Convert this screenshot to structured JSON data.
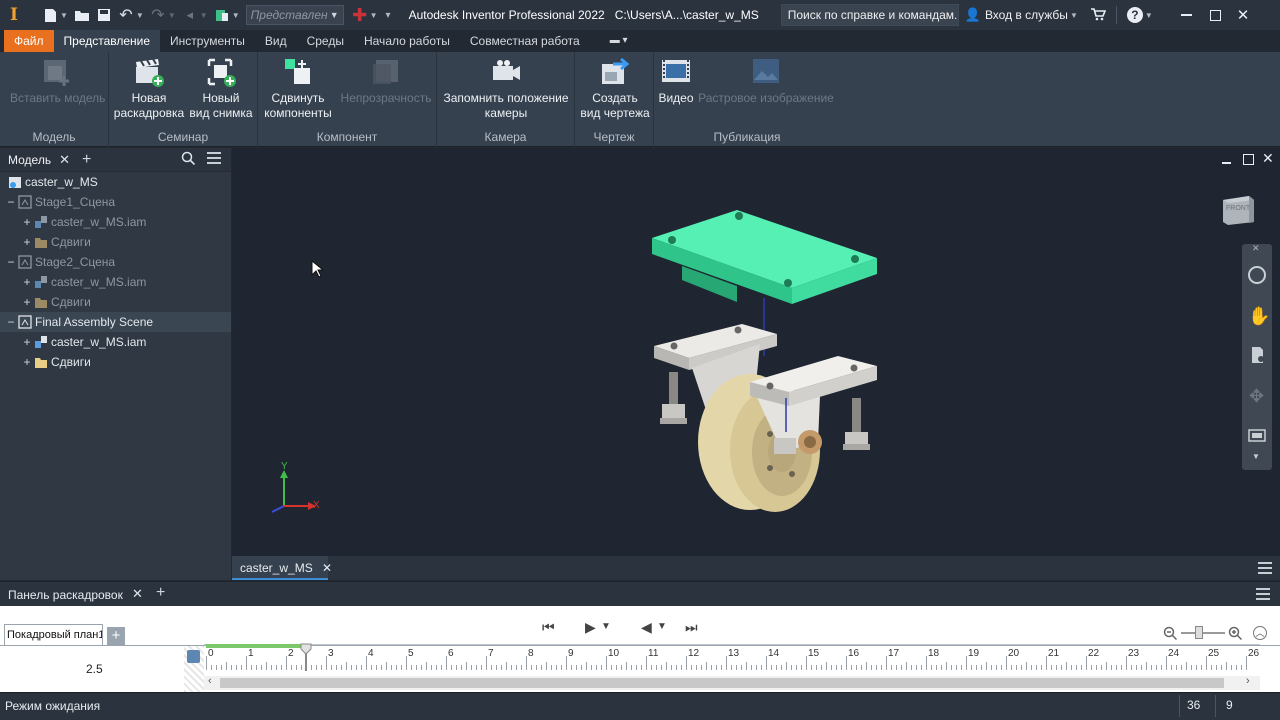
{
  "titlebar": {
    "representation_placeholder": "Представлен",
    "app_title": "Autodesk Inventor Professional 2022",
    "file_path": "C:\\Users\\A...\\caster_w_MS",
    "search_text": "Поиск по справке и командам.",
    "signin_label": "Вход в службы",
    "help_label": "?"
  },
  "menu_tabs": [
    "Файл",
    "Представление",
    "Инструменты",
    "Вид",
    "Среды",
    "Начало работы",
    "Совместная работа"
  ],
  "ribbon": {
    "panels": [
      {
        "title": "Модель",
        "buttons": [
          {
            "label": "Вставить модель"
          }
        ]
      },
      {
        "title": "Семинар",
        "buttons": [
          {
            "label_1": "Новая",
            "label_2": "раскадровка"
          },
          {
            "label_1": "Новый",
            "label_2": "вид снимка"
          }
        ]
      },
      {
        "title": "Компонент",
        "buttons": [
          {
            "label_1": "Сдвинуть",
            "label_2": "компоненты"
          },
          {
            "label": "Непрозрачность"
          }
        ]
      },
      {
        "title": "Камера",
        "buttons": [
          {
            "label_1": "Запомнить положение",
            "label_2": "камеры"
          }
        ]
      },
      {
        "title": "Чертеж",
        "buttons": [
          {
            "label_1": "Создать",
            "label_2": "вид чертежа"
          }
        ]
      },
      {
        "title": "Публикация",
        "buttons": [
          {
            "label": "Видео"
          },
          {
            "label": "Растровое изображение"
          }
        ]
      }
    ]
  },
  "browser": {
    "tab_label": "Модель",
    "tree": [
      {
        "label": "caster_w_MS",
        "level": 0,
        "exp": "",
        "kind": "root",
        "dim": false
      },
      {
        "label": "Stage1_Сцена",
        "level": 0,
        "exp": "−",
        "kind": "scene",
        "dim": true
      },
      {
        "label": "caster_w_MS.iam",
        "level": 1,
        "exp": "+",
        "kind": "assembly",
        "dim": true
      },
      {
        "label": "Сдвиги",
        "level": 1,
        "exp": "+",
        "kind": "folder",
        "dim": true
      },
      {
        "label": "Stage2_Сцена",
        "level": 0,
        "exp": "−",
        "kind": "scene",
        "dim": true
      },
      {
        "label": "caster_w_MS.iam",
        "level": 1,
        "exp": "+",
        "kind": "assembly",
        "dim": true
      },
      {
        "label": "Сдвиги",
        "level": 1,
        "exp": "+",
        "kind": "folder",
        "dim": true
      },
      {
        "label": "Final Assembly Scene",
        "level": 0,
        "exp": "−",
        "kind": "scene",
        "dim": false
      },
      {
        "label": "caster_w_MS.iam",
        "level": 1,
        "exp": "+",
        "kind": "assembly",
        "dim": false
      },
      {
        "label": "Сдвиги",
        "level": 1,
        "exp": "+",
        "kind": "folder",
        "dim": false
      }
    ]
  },
  "viewport": {
    "viewcube_label": "FRONT",
    "axis_x": "X",
    "axis_y": "Y"
  },
  "document_tab": "caster_w_MS",
  "storyboard": {
    "panel_title": "Панель раскадровок",
    "storyboard_tab": "Покадровый план1",
    "current_time": "2.5",
    "ruler_labels": [
      "0",
      "1",
      "2",
      "3",
      "4",
      "5",
      "6",
      "7",
      "8",
      "9",
      "10",
      "11",
      "12",
      "13",
      "14",
      "15",
      "16",
      "17",
      "18",
      "19",
      "20",
      "21",
      "22",
      "23",
      "24",
      "25",
      "26"
    ]
  },
  "status": {
    "text": "Режим ожидания",
    "count1": "36",
    "count2": "9"
  },
  "colors": {
    "accent_orange": "#e8701f",
    "highlight_green": "#3fe3a0",
    "timeline_green": "#7cc96b"
  }
}
